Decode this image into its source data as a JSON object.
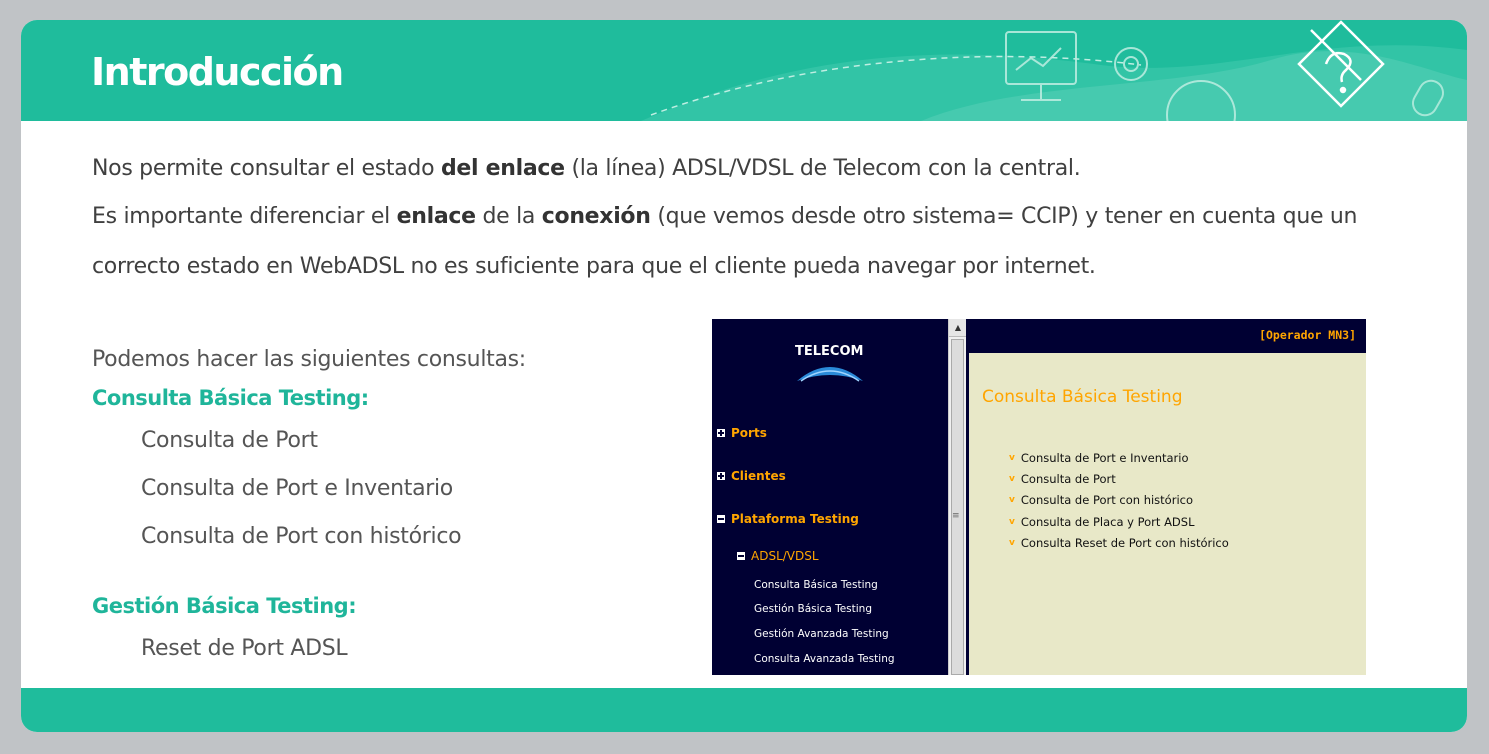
{
  "slide": {
    "title": "Introducción",
    "para1": {
      "pre": "Nos permite consultar el estado ",
      "bold": "del enlace",
      "post": " (la línea) ADSL/VDSL de Telecom con la central."
    },
    "para2": {
      "pre": "Es importante diferenciar el ",
      "bold1": "enlace",
      "mid": " de la ",
      "bold2": "conexión",
      "post": " (que vemos desde otro sistema= CCIP) y tener en cuenta que un"
    },
    "para3": "correcto estado en WebADSL no es suficiente para que el cliente pueda navegar por internet.",
    "intro_list": "Podemos hacer las siguientes consultas:",
    "section1": {
      "heading": "Consulta Básica Testing:",
      "items": [
        "Consulta de Port",
        "Consulta de Port e Inventario",
        "Consulta de Port con histórico"
      ]
    },
    "section2": {
      "heading": "Gestión Básica Testing:",
      "items": [
        "Reset de Port  ADSL"
      ]
    },
    "accent_color": "#1fbc9c"
  },
  "app": {
    "logo": "TELECOM",
    "operator": "[Operador MN3]",
    "nav": {
      "ports": "Ports",
      "clientes": "Clientes",
      "plataforma": "Plataforma Testing",
      "adsl": "ADSL/VDSL",
      "leaves": [
        "Consulta Básica Testing",
        "Gestión Básica Testing",
        "Gestión Avanzada Testing",
        "Consulta Avanzada Testing"
      ]
    },
    "content_title": "Consulta Básica Testing",
    "links": [
      "Consulta de Port e Inventario",
      "Consulta de Port",
      "Consulta de Port con histórico",
      "Consulta de Placa y Port ADSL",
      "Consulta Reset de Port con histórico"
    ]
  }
}
